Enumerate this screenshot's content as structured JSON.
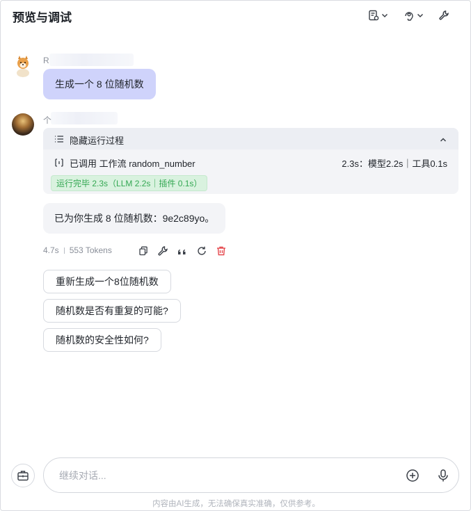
{
  "header": {
    "title": "预览与调试",
    "icons": [
      "settings-doc-icon",
      "debug-icon",
      "wrench-icon"
    ]
  },
  "user_message": {
    "name_initial": "R",
    "text": "生成一个 8 位随机数"
  },
  "bot_message": {
    "name_initial": "个",
    "process": {
      "toggle_label": "隐藏运行过程",
      "call_text": "已调用 工作流 random_number",
      "call_timing": "2.3s：模型2.2s｜工具0.1s",
      "status_badge": "运行完毕 2.3s（LLM 2.2s｜插件 0.1s）"
    },
    "text": "已为你生成 8 位随机数：9e2c89yo。",
    "meta": {
      "duration": "4.7s",
      "tokens": "553 Tokens"
    },
    "actions": [
      "copy-icon",
      "wrench-icon",
      "quote-icon",
      "refresh-icon",
      "delete-icon"
    ]
  },
  "suggestions": [
    "重新生成一个8位随机数",
    "随机数是否有重复的可能?",
    "随机数的安全性如何?"
  ],
  "input": {
    "placeholder": "继续对话..."
  },
  "disclaimer": "内容由AI生成，无法确保真实准确，仅供参考。",
  "colors": {
    "user_bubble": "#cfd3fb",
    "bot_bubble": "#f3f4f7",
    "success_text": "#34a853",
    "success_bg": "#d9f2df",
    "delete_red": "#e5484d"
  }
}
